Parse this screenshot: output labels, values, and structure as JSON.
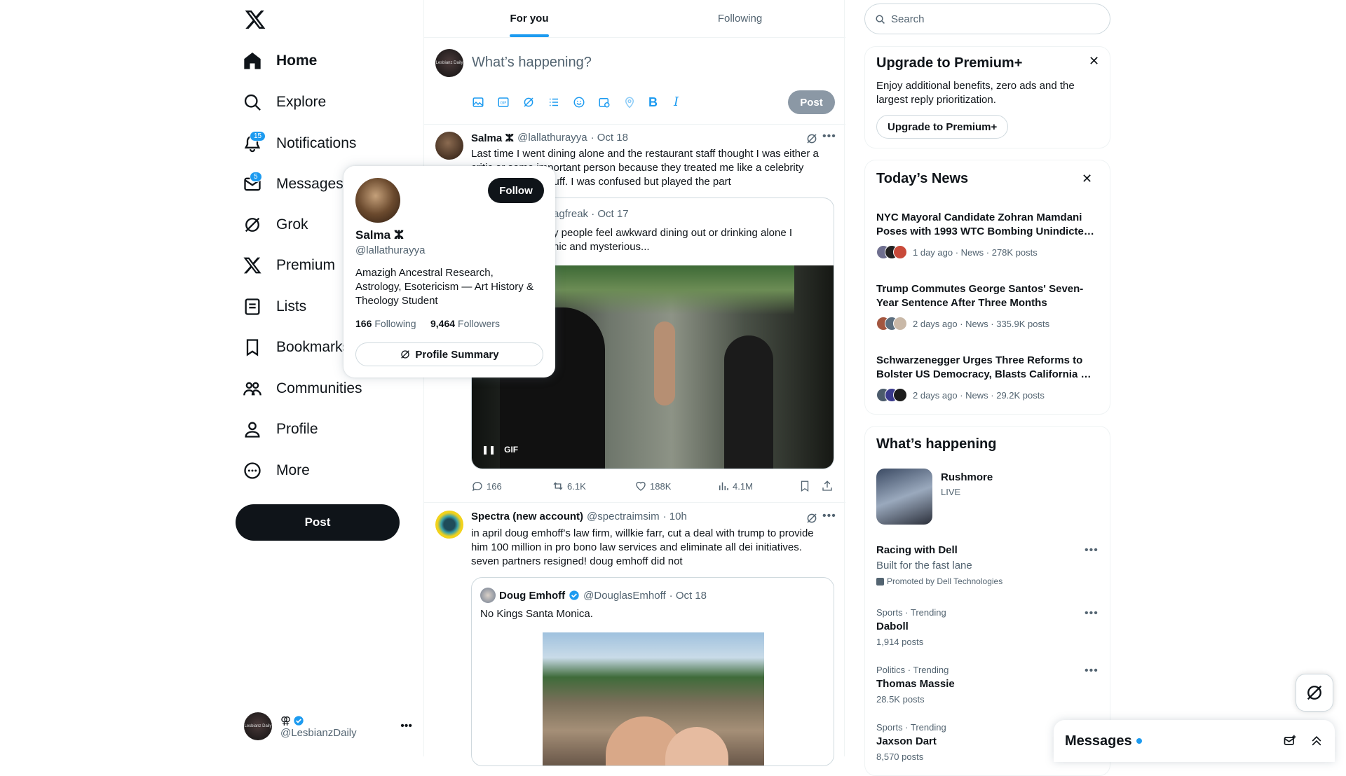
{
  "nav": {
    "items": [
      {
        "label": "Home",
        "icon": "home-icon"
      },
      {
        "label": "Explore",
        "icon": "search-icon"
      },
      {
        "label": "Notifications",
        "icon": "bell-icon",
        "badge": "15"
      },
      {
        "label": "Messages",
        "icon": "mail-icon",
        "badge": "5"
      },
      {
        "label": "Grok",
        "icon": "grok-icon"
      },
      {
        "label": "Premium",
        "icon": "x-logo-icon"
      },
      {
        "label": "Lists",
        "icon": "list-icon"
      },
      {
        "label": "Bookmarks",
        "icon": "bookmark-icon"
      },
      {
        "label": "Communities",
        "icon": "communities-icon"
      },
      {
        "label": "Profile",
        "icon": "person-icon"
      },
      {
        "label": "More",
        "icon": "more-circle-icon"
      }
    ],
    "post_label": "Post"
  },
  "account": {
    "avatar_text": "Lesbianz Daily",
    "handle": "@LesbianzDaily",
    "name_glyph": "⚢"
  },
  "tabs": {
    "for_you": "For you",
    "following": "Following"
  },
  "composer": {
    "placeholder": "What’s happening?",
    "post_label": "Post",
    "avatar_text": "Lesbianz Daily"
  },
  "tweet1": {
    "name": "Salma ⵣ",
    "handle": "@lallathurayya",
    "date": "· Oct 18",
    "text_line1": "Last time I went dining alone and the restaurant staff thought I was either a",
    "text_line2": "critic or some important person because they treated me like a celebrity",
    "text_line3": "& gave me free stuff. I was confused but played the part",
    "quote_handle": "agfreak · Oct 17",
    "quote_line1": "y people feel awkward dining out or drinking alone I",
    "quote_line2": "hic and mysterious...",
    "gif_label": "GIF",
    "replies": "166",
    "reposts": "6.1K",
    "likes": "188K",
    "views": "4.1M"
  },
  "tweet2": {
    "name": "Spectra (new account)",
    "handle": "@spectraimsim",
    "date": "· 10h",
    "text_line1": "in april doug emhoff's law firm, willkie farr, cut a deal with trump to provide",
    "text_line2": "him 100 million in pro bono law services and eliminate all dei initiatives.",
    "text_line3": "seven partners resigned! doug emhoff did not",
    "quote_name": "Doug Emhoff",
    "quote_handle": "@DouglasEmhoff",
    "quote_date": "· Oct 18",
    "quote_text": "No Kings Santa Monica."
  },
  "popup": {
    "name": "Salma ⵣ",
    "handle": "@lallathurayya",
    "follow_label": "Follow",
    "bio_line1": "Amazigh Ancestral Research,",
    "bio_line2": "Astrology, Esotericism — Art History &",
    "bio_line3": "Theology Student",
    "following_count": "166",
    "following_label": "Following",
    "followers_count": "9,464",
    "followers_label": "Followers",
    "summary_label": "Profile Summary"
  },
  "search": {
    "placeholder": "Search"
  },
  "premium": {
    "title": "Upgrade to Premium+",
    "line1": "Enjoy additional benefits, zero ads and the",
    "line2": "largest reply prioritization.",
    "button": "Upgrade to Premium+"
  },
  "news": {
    "title": "Today’s News",
    "items": [
      {
        "line1": "NYC Mayoral Candidate Zohran Mamdani",
        "line2": "Poses with 1993 WTC Bombing Unindicte…",
        "meta": "1 day ago · News · 278K posts"
      },
      {
        "line1": "Trump Commutes George Santos' Seven-",
        "line2": "Year Sentence After Three Months",
        "meta": "2 days ago · News · 335.9K posts"
      },
      {
        "line1": "Schwarzenegger Urges Three Reforms to",
        "line2": "Bolster US Democracy, Blasts California …",
        "meta": "2 days ago · News · 29.2K posts"
      }
    ]
  },
  "happening": {
    "title": "What’s happening",
    "live_name": "Rushmore",
    "live_status": "LIVE",
    "promo_title": "Racing with Dell",
    "promo_sub": "Built for the fast lane",
    "promo_by": "Promoted by Dell Technologies",
    "trends": [
      {
        "context": "Sports · Trending",
        "name": "Daboll",
        "count": "1,914 posts"
      },
      {
        "context": "Politics · Trending",
        "name": "Thomas Massie",
        "count": "28.5K posts"
      },
      {
        "context": "Sports · Trending",
        "name": "Jaxson Dart",
        "count": "8,570 posts"
      }
    ]
  },
  "messages_drawer": {
    "title": "Messages"
  },
  "colors": {
    "accent": "#1d9bf0",
    "text": "#0f1419",
    "muted": "#536471",
    "border": "#eff3f4"
  }
}
